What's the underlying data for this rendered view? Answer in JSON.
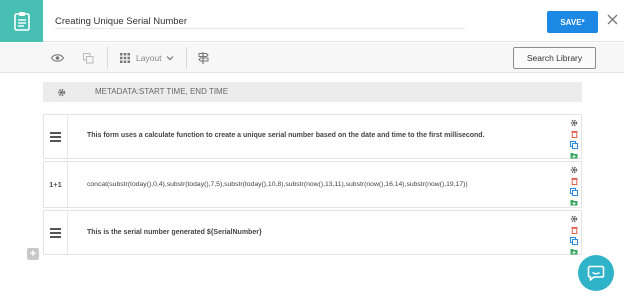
{
  "header": {
    "title": "Creating Unique Serial Number",
    "save_label": "SAVE*"
  },
  "toolbar": {
    "layout_label": "Layout",
    "search_library_label": "Search Library"
  },
  "metadata": {
    "text": "METADATA:START TIME, END TIME"
  },
  "rows": [
    {
      "gutter": "",
      "text": "This form uses a calculate function to create a unique serial number based on the date and time to the first millisecond."
    },
    {
      "gutter": "1+1",
      "text": "concat(substr(today(),0,4),substr(today(),7,5),substr(today(),10,8),substr(now(),13,11),substr(now(),16,14),substr(now(),19,17))"
    },
    {
      "gutter": "",
      "text": "This is the serial number generated ${SerialNumber}"
    }
  ],
  "add_block_label": "+",
  "colors": {
    "accent_teal": "#47c0b3",
    "save_blue": "#1e88e5",
    "chat_teal": "#2fb3c9",
    "action_red": "#e05a4f",
    "action_blue": "#2b8be0",
    "action_green": "#3aa65b"
  }
}
